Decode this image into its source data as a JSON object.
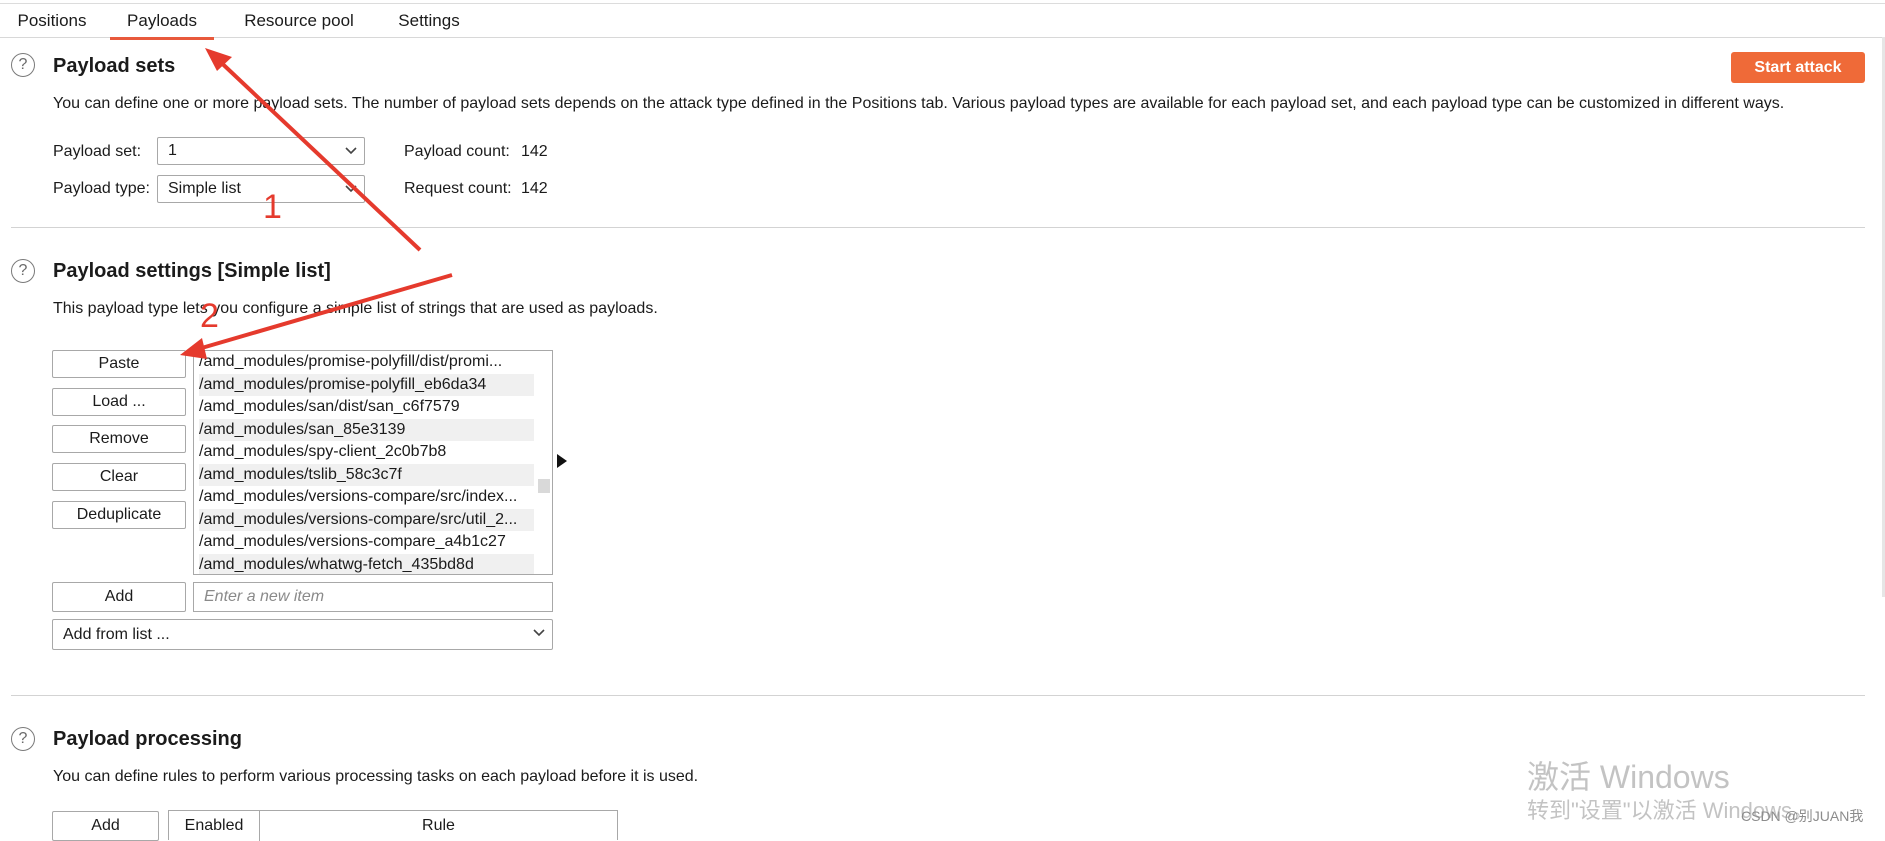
{
  "tabs": [
    "Positions",
    "Payloads",
    "Resource pool",
    "Settings"
  ],
  "active_tab": "Payloads",
  "payload_sets": {
    "title": "Payload sets",
    "start_attack": "Start attack",
    "description": "You can define one or more payload sets. The number of payload sets depends on the attack type defined in the Positions tab. Various payload types are available for each payload set, and each payload type can be customized in different ways.",
    "set_label": "Payload set:",
    "set_value": "1",
    "type_label": "Payload type:",
    "type_value": "Simple list",
    "payload_count_label": "Payload count:",
    "payload_count": "142",
    "request_count_label": "Request count:",
    "request_count": "142"
  },
  "payload_settings": {
    "title": "Payload settings [Simple list]",
    "description": "This payload type lets you configure a simple list of strings that are used as payloads.",
    "buttons": {
      "paste": "Paste",
      "load": "Load ...",
      "remove": "Remove",
      "clear": "Clear",
      "deduplicate": "Deduplicate",
      "add": "Add"
    },
    "items": [
      "/amd_modules/promise-polyfill/dist/promi...",
      "/amd_modules/promise-polyfill_eb6da34",
      "/amd_modules/san/dist/san_c6f7579",
      "/amd_modules/san_85e3139",
      "/amd_modules/spy-client_2c0b7b8",
      "/amd_modules/tslib_58c3c7f",
      "/amd_modules/versions-compare/src/index...",
      "/amd_modules/versions-compare/src/util_2...",
      "/amd_modules/versions-compare_a4b1c27",
      "/amd_modules/whatwg-fetch_435bd8d"
    ],
    "new_item_placeholder": "Enter a new item",
    "add_from_list": "Add from list ..."
  },
  "payload_processing": {
    "title": "Payload processing",
    "description": "You can define rules to perform various processing tasks on each payload before it is used.",
    "add_button": "Add",
    "columns": [
      "Enabled",
      "Rule"
    ]
  },
  "annotations": [
    "1",
    "2"
  ],
  "watermark": {
    "line1": "激活 Windows",
    "line2": "转到\"设置\"以激活 Windows。",
    "credit": "CSDN @别JUAN我"
  },
  "colors": {
    "accent": "#e8593c",
    "start_attack": "#ef6a38",
    "arrow": "#e53a2d"
  }
}
